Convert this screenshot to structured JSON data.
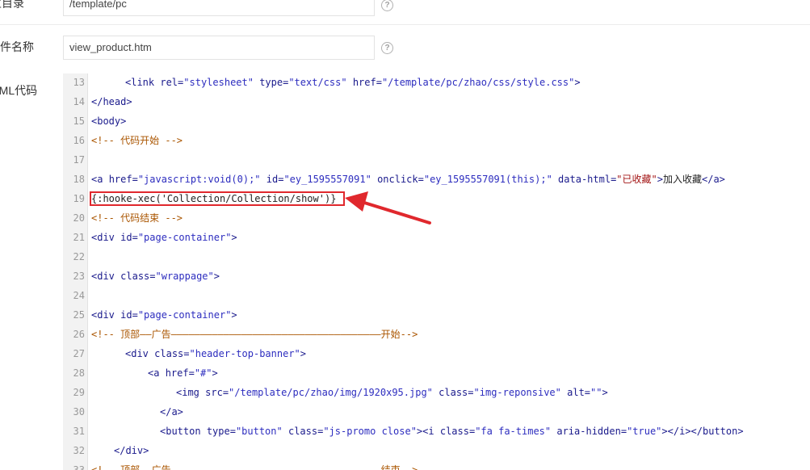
{
  "form": {
    "row1": {
      "label": "主目录",
      "value": "/template/pc"
    },
    "row2": {
      "label": "文件名称",
      "value": "view_product.htm"
    },
    "row3": {
      "label": "HTML代码"
    },
    "help_glyph": "?"
  },
  "editor": {
    "lines": [
      {
        "n": "13",
        "html": "<span style=\"padding-left:42px\"></span><span class=\"t\">&lt;link</span> <span class=\"a\">rel=</span><span class=\"s\">\"stylesheet\"</span> <span class=\"a\">type=</span><span class=\"s\">\"text/css\"</span> <span class=\"a\">href=</span><span class=\"s\">\"/template/pc/zhao/css/style.css\"</span><span class=\"t\">&gt;</span>"
      },
      {
        "n": "14",
        "html": "<span class=\"t\">&lt;/head&gt;</span>"
      },
      {
        "n": "15",
        "html": "<span class=\"t\">&lt;body&gt;</span>"
      },
      {
        "n": "16",
        "html": "<span class=\"c\">&lt;!-- 代码开始 --&gt;</span>"
      },
      {
        "n": "17",
        "html": ""
      },
      {
        "n": "18",
        "html": "<span class=\"t\">&lt;a</span> <span class=\"a\">href=</span><span class=\"s\">\"javascript:void(0);\"</span> <span class=\"a\">id=</span><span class=\"s\">\"ey_1595557091\"</span> <span class=\"a\">onclick=</span><span class=\"s\">\"ey_1595557091(this);\"</span> <span class=\"a\">data-html=</span><span class=\"sr\">\"已收藏\"</span><span class=\"t\">&gt;</span><span class=\"x\">加入收藏</span><span class=\"t\">&lt;/a&gt;</span>"
      },
      {
        "n": "19",
        "html": "<span class=\"x\">{:hooke-xec('Collection/Collection/show')}</span>"
      },
      {
        "n": "20",
        "html": "<span class=\"c\">&lt;!-- 代码结束 --&gt;</span>"
      },
      {
        "n": "21",
        "html": "<span class=\"t\">&lt;div</span> <span class=\"a\">id=</span><span class=\"s\">\"page-container\"</span><span class=\"t\">&gt;</span>"
      },
      {
        "n": "22",
        "html": ""
      },
      {
        "n": "23",
        "html": "<span class=\"t\">&lt;div</span> <span class=\"a\">class=</span><span class=\"s\">\"wrappage\"</span><span class=\"t\">&gt;</span>"
      },
      {
        "n": "24",
        "html": ""
      },
      {
        "n": "25",
        "html": "<span class=\"t\">&lt;div</span> <span class=\"a\">id=</span><span class=\"s\">\"page-container\"</span><span class=\"t\">&gt;</span>"
      },
      {
        "n": "26",
        "html": "<span class=\"c\">&lt;!-- 顶部——广告————————————————————————————————————开始--&gt;</span>"
      },
      {
        "n": "27",
        "html": "<span style=\"padding-left:42px\"></span><span class=\"t\">&lt;div</span> <span class=\"a\">class=</span><span class=\"s\">\"header-top-banner\"</span><span class=\"t\">&gt;</span>"
      },
      {
        "n": "28",
        "html": "<span style=\"padding-left:70px\"></span><span class=\"t\">&lt;a</span> <span class=\"a\">href=</span><span class=\"s\">\"#\"</span><span class=\"t\">&gt;</span>"
      },
      {
        "n": "29",
        "html": "<span style=\"padding-left:105px\"></span><span class=\"t\">&lt;img</span> <span class=\"a\">src=</span><span class=\"s\">\"/template/pc/zhao/img/1920x95.jpg\"</span> <span class=\"a\">class=</span><span class=\"s\">\"img-reponsive\"</span> <span class=\"a\">alt=</span><span class=\"s\">\"\"</span><span class=\"t\">&gt;</span>"
      },
      {
        "n": "30",
        "html": "<span style=\"padding-left:85px\"></span><span class=\"t\">&lt;/a&gt;</span>"
      },
      {
        "n": "31",
        "html": "<span style=\"padding-left:85px\"></span><span class=\"t\">&lt;button</span> <span class=\"a\">type=</span><span class=\"s\">\"button\"</span> <span class=\"a\">class=</span><span class=\"s\">\"js-promo close\"</span><span class=\"t\">&gt;&lt;i</span> <span class=\"a\">class=</span><span class=\"s\">\"fa fa-times\"</span> <span class=\"a\">aria-hidden=</span><span class=\"s\">\"true\"</span><span class=\"t\">&gt;&lt;/i&gt;&lt;/button&gt;</span>"
      },
      {
        "n": "32",
        "html": "<span style=\"padding-left:28px\"></span><span class=\"t\">&lt;/div&gt;</span>"
      },
      {
        "n": "33",
        "html": "<span class=\"c\">&lt;!-- 顶部——广告————————————————————————————————————结束--&gt;</span>"
      }
    ]
  },
  "colors": {
    "highlight": "#e0282d",
    "arrow": "#e0282d"
  },
  "icons": {
    "help": "question-circle-icon",
    "annotation": "red-arrow-annotation"
  }
}
